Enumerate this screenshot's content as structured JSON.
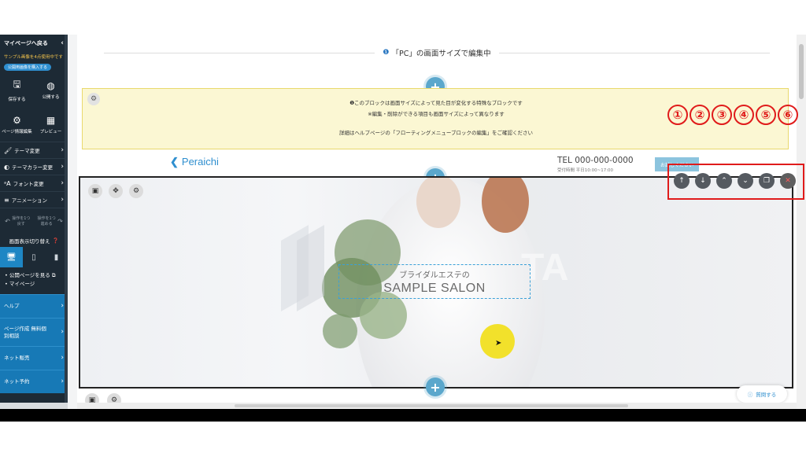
{
  "sidebar": {
    "back_label": "マイページへ戻る",
    "sample_notice": "サンプル画像を4点使用中です",
    "upgrade_label": "公開用画像を購入する",
    "save_label": "保存する",
    "publish_label": "公開する",
    "page_info_label": "ページ情報編集",
    "preview_label": "プレビュー",
    "menu": [
      "テーマ変更",
      "テーマカラー変更",
      "フォント変更",
      "アニメーション"
    ],
    "undo_label": "操作を1つ戻す",
    "redo_label": "操作を1つ進める",
    "display_switch_title": "画面表示切り替え",
    "links": [
      "公開ページを見る",
      "マイページ"
    ],
    "help_label": "ヘルプ",
    "consult_label": "ページ作成 無料個別相談",
    "net_sales_label": "ネット販売",
    "next_label": "ネット予約"
  },
  "editor": {
    "pc_bar_label": "「PC」の画面サイズで編集中",
    "notice_lines": [
      "このブロックは画面サイズによって見た目が変化する特殊なブロックです",
      "※編集・削除ができる項目も画面サイズによって異なります",
      "詳細はヘルプページの「フローティングメニューブロックの編集」をご確認ください"
    ],
    "logo_text": "Peraichi",
    "tel": "TEL 000-000-0000",
    "hours": "受付時間 平日10:00~17:00",
    "trial_button": "お試しください",
    "hero_caption_sub": "ブライダルエステの",
    "hero_caption_main": "SAMPLE SALON",
    "help_button": "質問する"
  },
  "annotation_numbers": [
    "①",
    "②",
    "③",
    "④",
    "⑤",
    "⑥"
  ],
  "colors": {
    "sidebar_bg": "#1d2a35",
    "sidebar_blue": "#1779b6",
    "accent": "#5ba7cc",
    "highlight_red": "#e01b1b",
    "notice_bg": "#fbf7d3"
  }
}
